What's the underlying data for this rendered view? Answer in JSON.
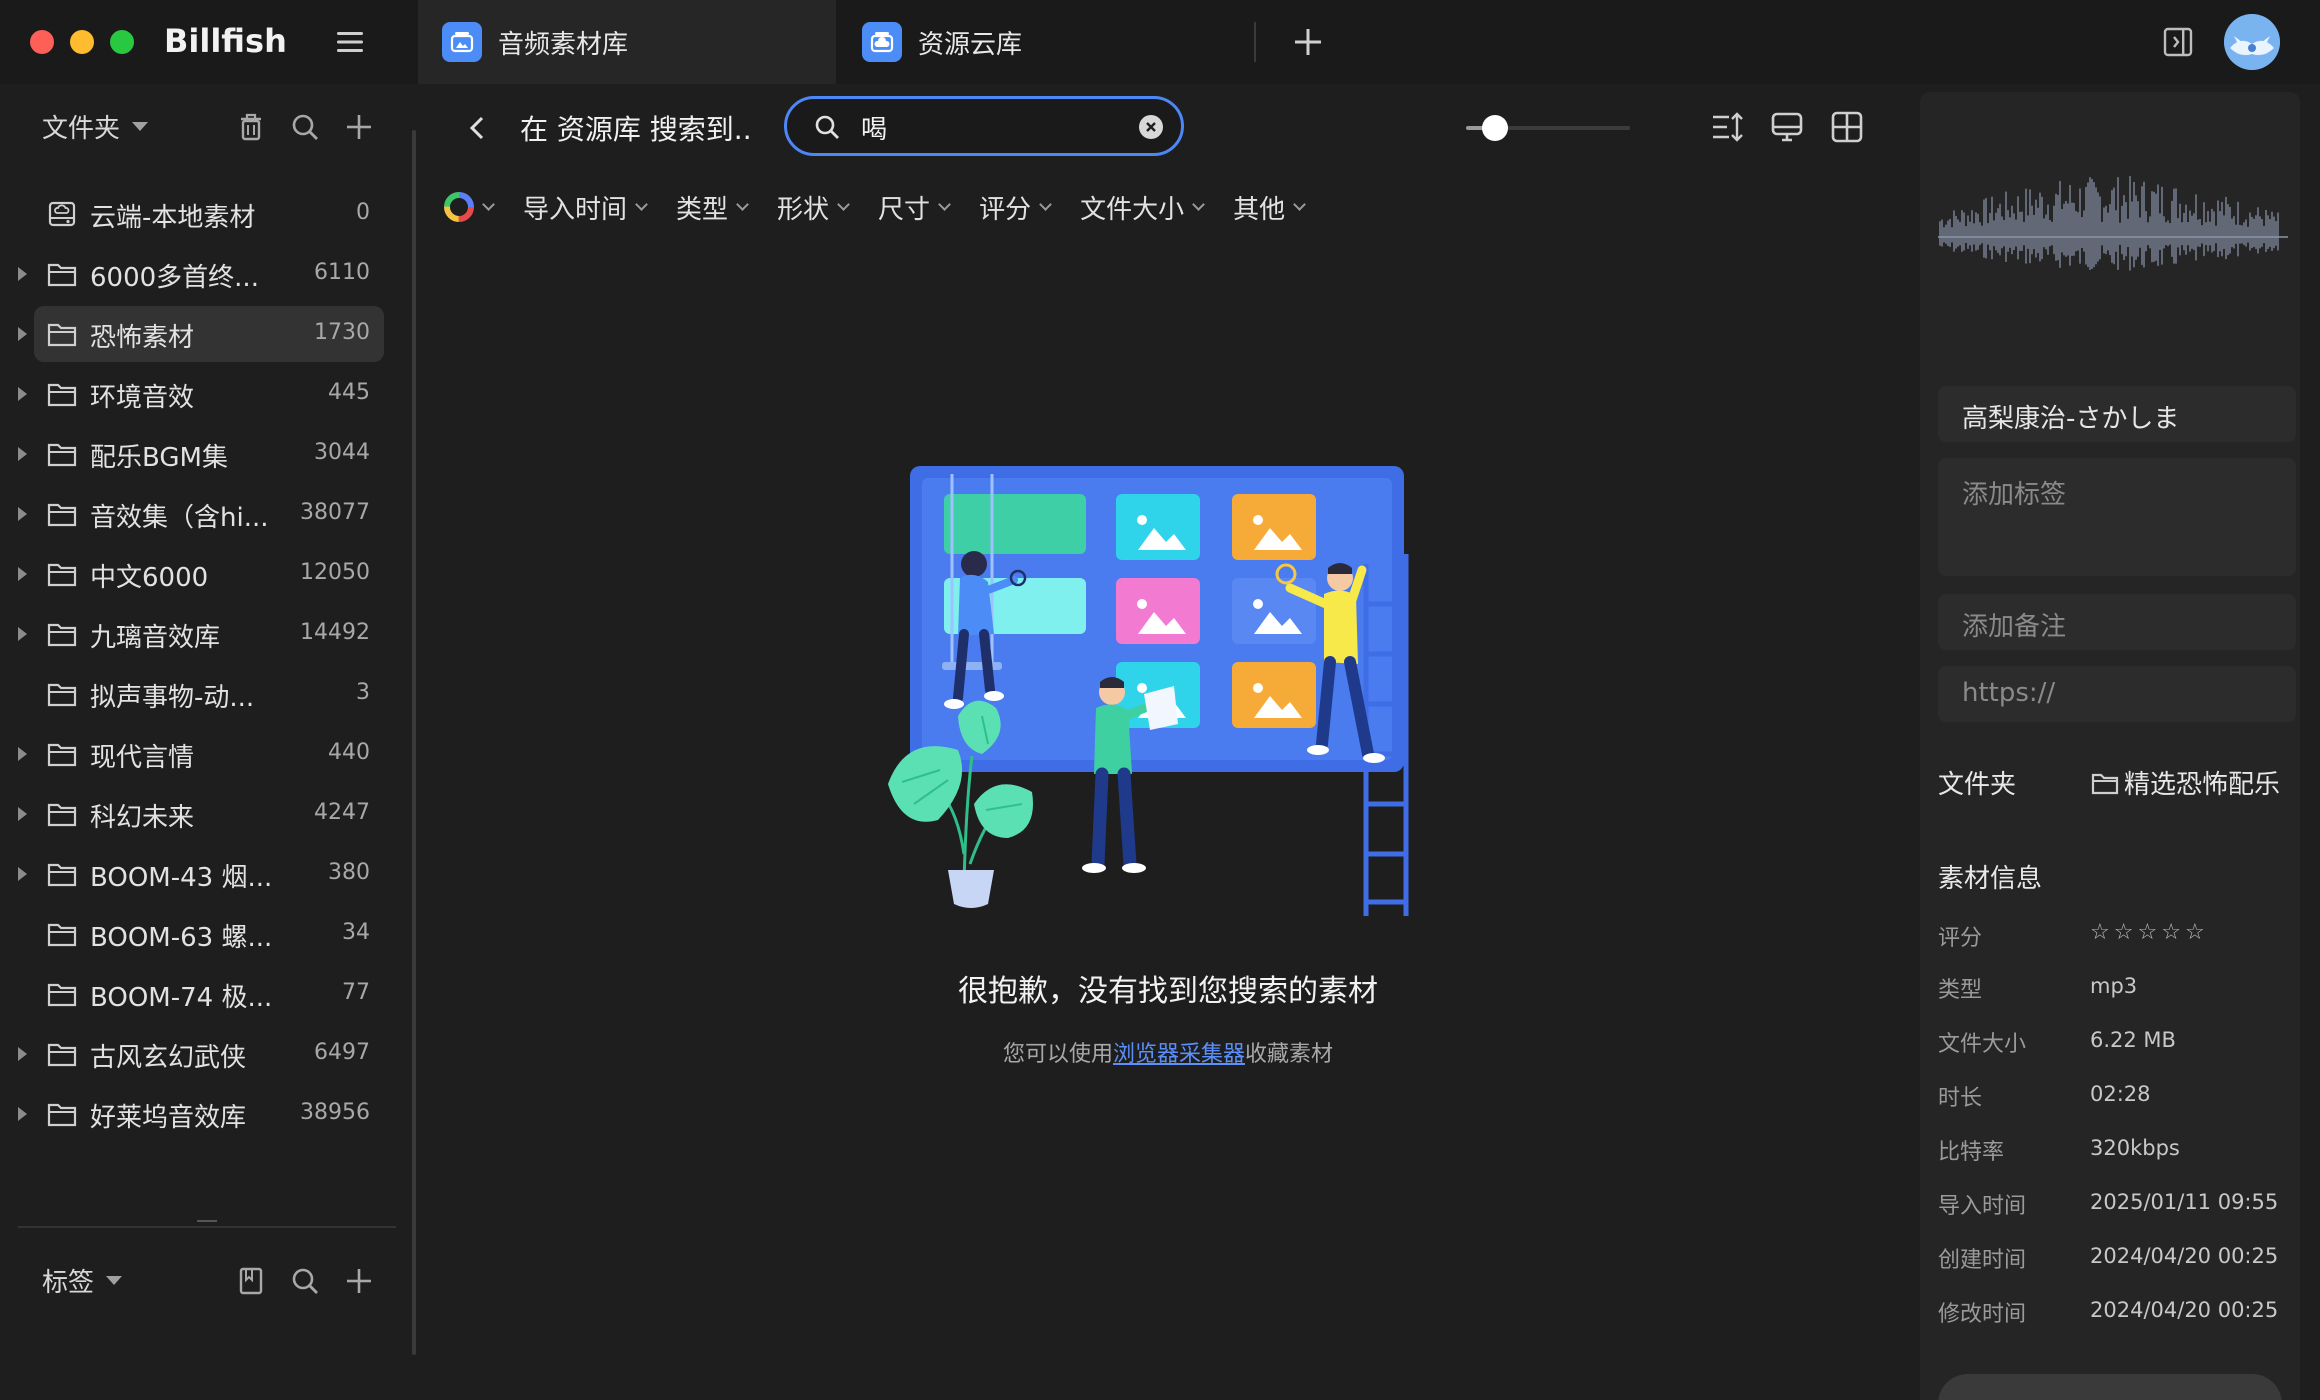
{
  "app": {
    "name": "Billfish"
  },
  "tabs": [
    {
      "label": "音频素材库",
      "icon": "library-icon",
      "active": true
    },
    {
      "label": "资源云库",
      "icon": "cloud-library-icon",
      "active": false
    }
  ],
  "colors": {
    "accent": "#4d86f5",
    "link": "#5b8ff9",
    "selected_row": "#333333"
  },
  "sidebar": {
    "folders_label": "文件夹",
    "tags_label": "标签",
    "folders": [
      {
        "label": "云端-本地素材",
        "count": "0",
        "expandable": false,
        "icon": "cloud-drive-icon"
      },
      {
        "label": "6000多首终...",
        "count": "6110",
        "expandable": true,
        "icon": "folder-icon"
      },
      {
        "label": "恐怖素材",
        "count": "1730",
        "expandable": true,
        "icon": "folder-icon",
        "selected": true
      },
      {
        "label": "环境音效",
        "count": "445",
        "expandable": true,
        "icon": "folder-icon"
      },
      {
        "label": "配乐BGM集",
        "count": "3044",
        "expandable": true,
        "icon": "folder-icon"
      },
      {
        "label": "音效集（含hi...",
        "count": "38077",
        "expandable": true,
        "icon": "folder-icon"
      },
      {
        "label": "中文6000",
        "count": "12050",
        "expandable": true,
        "icon": "folder-icon"
      },
      {
        "label": "九璃音效库",
        "count": "14492",
        "expandable": true,
        "icon": "folder-icon"
      },
      {
        "label": "拟声事物-动...",
        "count": "3",
        "expandable": false,
        "icon": "folder-icon"
      },
      {
        "label": "现代言情",
        "count": "440",
        "expandable": true,
        "icon": "folder-icon"
      },
      {
        "label": "科幻未来",
        "count": "4247",
        "expandable": true,
        "icon": "folder-icon"
      },
      {
        "label": "BOOM-43 烟...",
        "count": "380",
        "expandable": true,
        "icon": "folder-icon"
      },
      {
        "label": "BOOM-63 螺...",
        "count": "34",
        "expandable": false,
        "icon": "folder-icon"
      },
      {
        "label": "BOOM-74 极...",
        "count": "77",
        "expandable": false,
        "icon": "folder-icon"
      },
      {
        "label": "古风玄幻武侠",
        "count": "6497",
        "expandable": true,
        "icon": "folder-icon"
      },
      {
        "label": "好莱坞音效库",
        "count": "38956",
        "expandable": true,
        "icon": "folder-icon"
      }
    ]
  },
  "toolbar": {
    "search_context": "在 资源库 搜索到..",
    "search_value": "喝",
    "zoom_level": 0.12
  },
  "filters": [
    "导入时间",
    "类型",
    "形状",
    "尺寸",
    "评分",
    "文件大小",
    "其他"
  ],
  "empty_state": {
    "title": "很抱歉，没有找到您搜索的素材",
    "hint_prefix": "您可以使用",
    "hint_link": "浏览器采集器",
    "hint_suffix": "收藏素材"
  },
  "inspector": {
    "file_name": "高梨康治-さかしま",
    "tags_placeholder": "添加标签",
    "notes_placeholder": "添加备注",
    "url_placeholder": "https://",
    "folder_label": "文件夹",
    "folder_value": "精选恐怖配乐",
    "info_title": "素材信息",
    "rating_label": "评分",
    "rating_value": 0,
    "rating_max": 5,
    "info": [
      {
        "key": "类型",
        "value": "mp3"
      },
      {
        "key": "文件大小",
        "value": "6.22 MB"
      },
      {
        "key": "时长",
        "value": "02:28"
      },
      {
        "key": "比特率",
        "value": "320kbps"
      },
      {
        "key": "导入时间",
        "value": "2025/01/11 09:55"
      },
      {
        "key": "创建时间",
        "value": "2024/04/20 00:25"
      },
      {
        "key": "修改时间",
        "value": "2024/04/20 00:25"
      }
    ]
  }
}
